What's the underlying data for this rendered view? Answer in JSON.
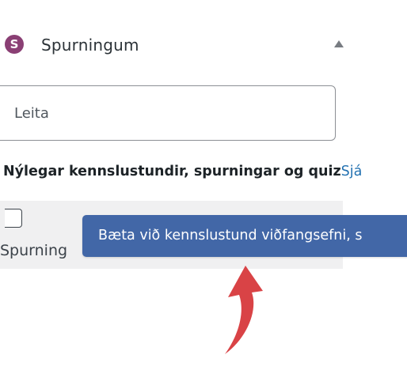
{
  "panel": {
    "logo_letter": "S",
    "title": "Spurningum",
    "collapse_icon": "triangle-up-icon"
  },
  "search": {
    "placeholder": "Leita",
    "value": ""
  },
  "recent": {
    "heading": "Nýlegar kennslustundir, spurningar og quiz",
    "view_link": "Sjá"
  },
  "result": {
    "label": "Spurning",
    "checked": false
  },
  "tooltip": {
    "text": "Bæta við kennslustund viðfangsefni, s"
  },
  "annotation": {
    "icon": "red-curved-arrow-icon"
  },
  "colors": {
    "logo": "#8a3f74",
    "tooltip_bg": "#4267a7",
    "link": "#2271b1",
    "arrow": "#d94346",
    "result_bg": "#f0f0f1"
  }
}
